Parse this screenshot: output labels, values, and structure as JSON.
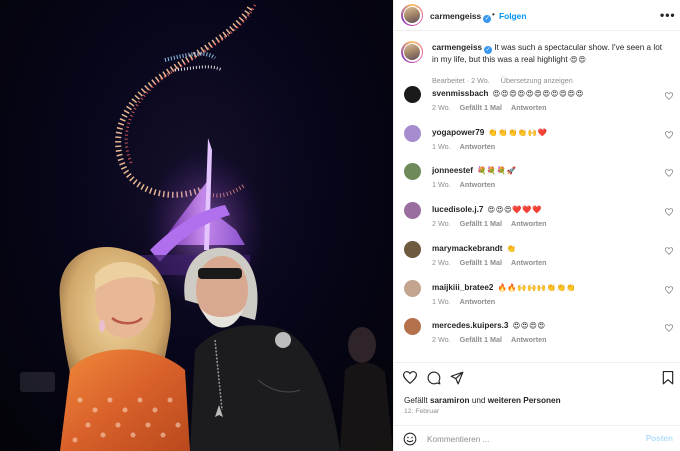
{
  "post": {
    "author": "carmengeiss",
    "follow_label": "Folgen",
    "separator": "•",
    "more_label": "•••",
    "caption": "It was such a spectacular show. I've seen a lot in my life, but this was a real highlight",
    "caption_emoji": "😍😍",
    "caption_meta_edited": "Bearbeitet · 2 Wo.",
    "caption_meta_translate": "Übersetzung anzeigen"
  },
  "comments": [
    {
      "user": "svenmissbach",
      "text": "😍😍😍😍😍😍😍😍😍😍😍",
      "time": "2 Wo.",
      "likes": "Gefällt 1 Mal",
      "reply": "Antworten",
      "avatar_color": "#1a1a1a"
    },
    {
      "user": "yogapower79",
      "text": "👏👏👏👏🙌❤️",
      "time": "1 Wo.",
      "likes": "",
      "reply": "Antworten",
      "avatar_color": "#a78bcf"
    },
    {
      "user": "jonneestef",
      "text": "💐💐💐🚀",
      "time": "1 Wo.",
      "likes": "",
      "reply": "Antworten",
      "avatar_color": "#6f8a5a"
    },
    {
      "user": "lucedisole.j.7",
      "text": "😍😍😍❤️❤️❤️",
      "time": "2 Wo.",
      "likes": "Gefällt 1 Mal",
      "reply": "Antworten",
      "avatar_color": "#9a6fa0"
    },
    {
      "user": "marymackebrandt",
      "text": "👏",
      "time": "2 Wo.",
      "likes": "Gefällt 1 Mal",
      "reply": "Antworten",
      "avatar_color": "#6d5a3f"
    },
    {
      "user": "maijkiii_bratee2",
      "text": "🔥🔥🙌🙌🙌👏👏👏",
      "time": "1 Wo.",
      "likes": "",
      "reply": "Antworten",
      "avatar_color": "#c3a58f"
    },
    {
      "user": "mercedes.kuipers.3",
      "text": "😍😍😍😍",
      "time": "2 Wo.",
      "likes": "Gefällt 1 Mal",
      "reply": "Antworten",
      "avatar_color": "#b5704c"
    }
  ],
  "actions": {
    "liked_by_prefix": "Gefällt",
    "liked_by_user": "saramiron",
    "liked_by_and": "und",
    "liked_by_others": "weiteren Personen",
    "date": "12. Februar"
  },
  "composer": {
    "placeholder": "Kommentieren ...",
    "post_label": "Posten"
  },
  "colors": {
    "accent": "#0095f6",
    "verified": "#3897f0",
    "muted": "#8e8e8e",
    "post_disabled": "#b2dffc"
  }
}
